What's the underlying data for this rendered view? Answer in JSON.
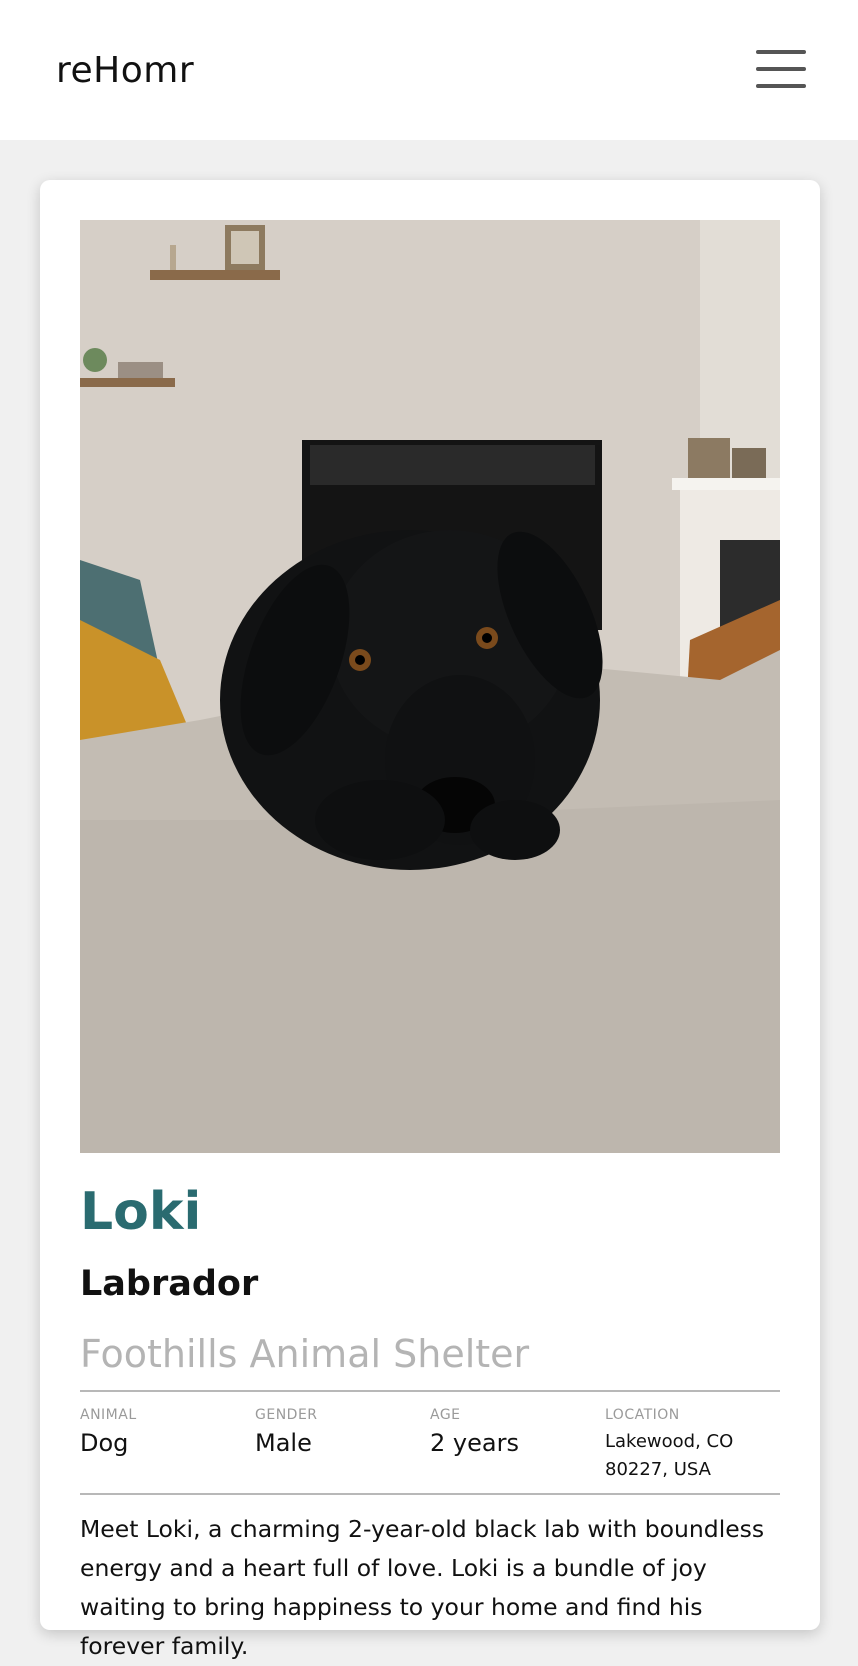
{
  "header": {
    "brand": "reHomr",
    "menu_icon": "hamburger-menu-icon"
  },
  "pet": {
    "name": "Loki",
    "breed": "Labrador",
    "shelter": "Foothills Animal Shelter",
    "attributes": [
      {
        "label": "ANIMAL",
        "value": "Dog"
      },
      {
        "label": "GENDER",
        "value": "Male"
      },
      {
        "label": "AGE",
        "value": "2 years"
      },
      {
        "label": "LOCATION",
        "value_line1": "Lakewood, CO",
        "value_line2": "80227, USA"
      }
    ],
    "description": "Meet Loki, a charming 2-year-old black lab with boundless energy and a heart full of love. Loki is a bundle of joy waiting to bring happiness to your home and find his forever family."
  },
  "colors": {
    "accent": "#2a6b70",
    "muted_text": "#b4b4b4",
    "label_text": "#9a9a9a",
    "page_background": "#f0f0f0"
  }
}
